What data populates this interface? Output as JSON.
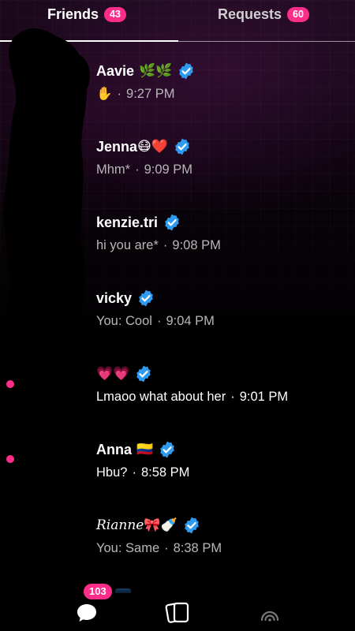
{
  "tabs": {
    "friends": {
      "label": "Friends",
      "count": "43"
    },
    "requests": {
      "label": "Requests",
      "count": "60"
    }
  },
  "chats": [
    {
      "name": "Aavie",
      "emoji": "🌿🌿",
      "verified": true,
      "message": "✋",
      "time": "9:27 PM",
      "unread": false
    },
    {
      "name": "Jenna",
      "emoji": "😷❤️",
      "verified": true,
      "message": "Mhm*",
      "time": "9:09 PM",
      "unread": false
    },
    {
      "name": "kenzie.tri",
      "emoji": "",
      "verified": true,
      "message": "hi you are*",
      "time": "9:08 PM",
      "unread": false
    },
    {
      "name": "vicky",
      "emoji": "",
      "verified": true,
      "message": "You: Cool",
      "time": "9:04 PM",
      "unread": false
    },
    {
      "name": "",
      "emoji": "💗💗",
      "verified": true,
      "message": "Lmaoo what about her",
      "time": "9:01 PM",
      "unread": true
    },
    {
      "name": "Anna",
      "emoji": "🇨🇴",
      "verified": true,
      "message": "Hbu?",
      "time": "8:58 PM",
      "unread": true
    },
    {
      "name": "𝑅𝑖𝑎𝑛𝑛𝑒",
      "emoji": "🎀🍼",
      "verified": true,
      "message": "You: Same",
      "time": "8:38 PM",
      "unread": false
    }
  ],
  "separator": "·",
  "nav": {
    "chats_badge": "103"
  },
  "colors": {
    "accent": "#ff2d8a",
    "verified": "#2f9bf0"
  }
}
